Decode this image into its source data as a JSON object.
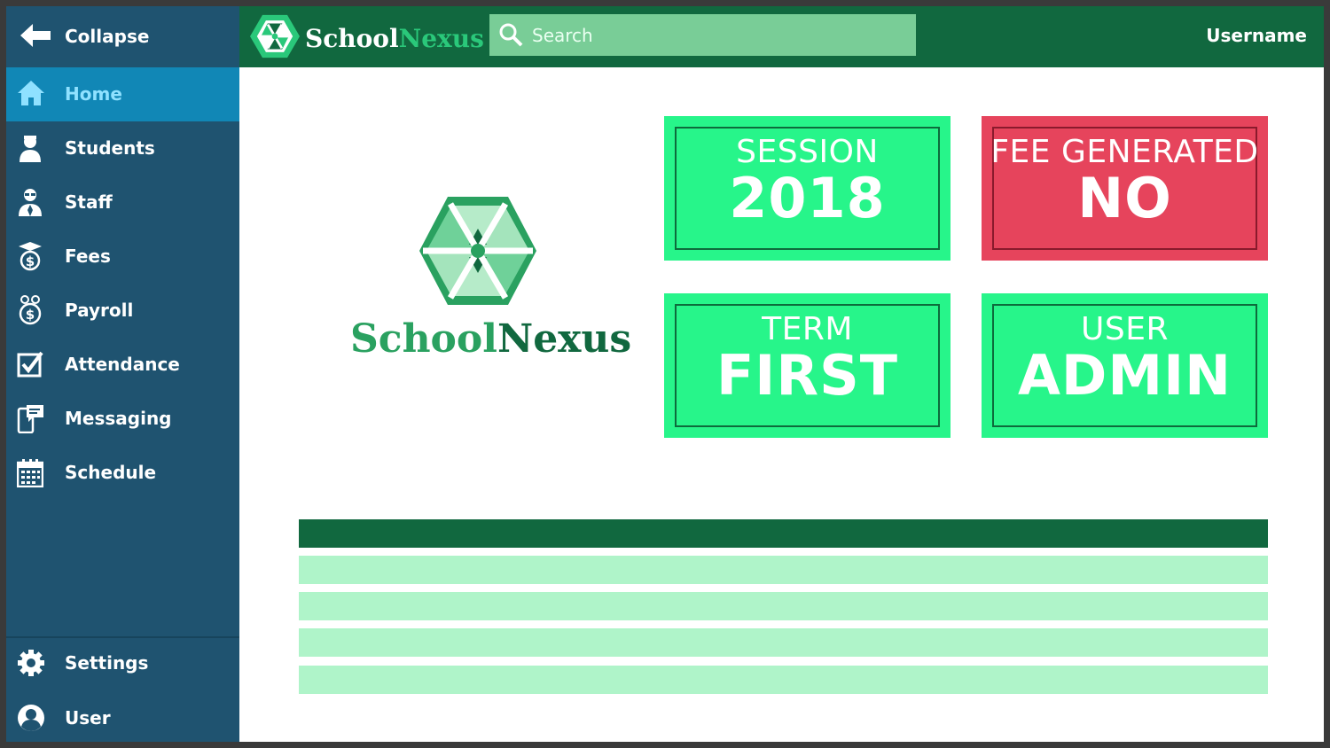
{
  "sidebar": {
    "collapse_label": "Collapse",
    "items": [
      {
        "label": "Home",
        "icon": "home-icon",
        "active": true
      },
      {
        "label": "Students",
        "icon": "student-icon"
      },
      {
        "label": "Staff",
        "icon": "staff-icon"
      },
      {
        "label": "Fees",
        "icon": "fees-icon"
      },
      {
        "label": "Payroll",
        "icon": "payroll-icon"
      },
      {
        "label": "Attendance",
        "icon": "checkbox-icon"
      },
      {
        "label": "Messaging",
        "icon": "chat-phone-icon"
      },
      {
        "label": "Schedule",
        "icon": "calendar-icon"
      }
    ],
    "bottom_items": [
      {
        "label": "Settings",
        "icon": "gear-icon"
      },
      {
        "label": "User",
        "icon": "user-icon"
      }
    ]
  },
  "header": {
    "brand_school": "School",
    "brand_nexus": "Nexus",
    "search_placeholder": "Search",
    "username": "Username"
  },
  "main": {
    "logo_school": "School",
    "logo_nexus": "Nexus",
    "cards": [
      {
        "label": "SESSION",
        "value": "2018",
        "status": "green"
      },
      {
        "label": "FEE GENERATED",
        "value": "NO",
        "status": "red"
      },
      {
        "label": "TERM",
        "value": "FIRST",
        "status": "green"
      },
      {
        "label": "USER",
        "value": "ADMIN",
        "status": "green"
      }
    ]
  },
  "colors": {
    "sidebar": "#1f5370",
    "sidebar_active": "#1187b6",
    "topbar": "#11683f",
    "card_green": "#27f58a",
    "card_red": "#e6445c",
    "table_row": "#aff4c9"
  }
}
